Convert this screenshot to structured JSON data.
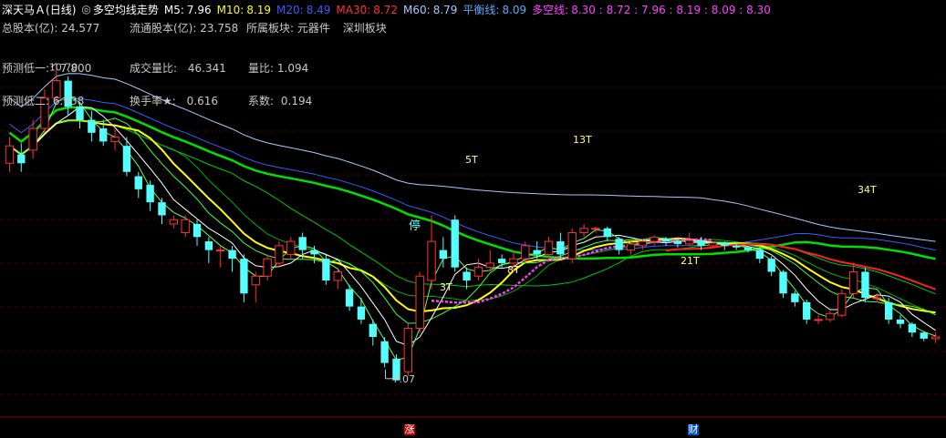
{
  "header": {
    "stock": "深天马Ａ",
    "period": "(日线)",
    "indicator_name": "多空均线走势",
    "ma": [
      {
        "label": "M5:",
        "value": "7.96",
        "color": "#ffffff"
      },
      {
        "label": "M10:",
        "value": "8.19",
        "color": "#ffff00"
      },
      {
        "label": "M20:",
        "value": "8.49",
        "color": "#3a5bff"
      },
      {
        "label": "MA30:",
        "value": "8.72",
        "color": "#ff3030"
      },
      {
        "label": "M60:",
        "value": "8.79",
        "color": "#a6c8ff"
      },
      {
        "label": "平衡线:",
        "value": "8.09",
        "color": "#5fa8ff"
      },
      {
        "label": "多空线:",
        "value": "8.30 : 8.72 : 7.96 : 8.19 : 8.09 : 8.30",
        "color": "#ff40ff"
      }
    ]
  },
  "info": {
    "total_shares_label": "总股本(亿):",
    "total_shares": "24.577",
    "float_shares_label": "流通股本(亿):",
    "float_shares": "23.758",
    "sector_label": "所属板块:",
    "sector": "元器件",
    "board": "深圳板块",
    "pred_low1_label": "预测低一:",
    "pred_low1": "7.800",
    "volume_ratio_label": "成交量比:",
    "volume_ratio": "46.341",
    "liang_bi_label": "量比:",
    "liang_bi": "1.094",
    "pred_low2_label": "预测低二:",
    "pred_low2": "6.938",
    "turnover_label": "换手率★:",
    "turnover": "0.616",
    "coef_label": "系数:",
    "coef": "0.194"
  },
  "annotations": {
    "high_price": "10.70",
    "low_price": "7.07",
    "stop_mark": "停",
    "t5": "5T",
    "t13": "13T",
    "t34": "34T",
    "t3": "3T",
    "t8": "8T",
    "t21": "21T"
  },
  "badges": {
    "zhang": "涨",
    "cai": "财"
  },
  "colors": {
    "up": "#ff3232",
    "down": "#54ffff",
    "grid": "#7a0000",
    "m5": "#ffffff",
    "m10": "#ffff00",
    "ma30": "#ff2020",
    "m60": "#a6c8ff",
    "green_ma": "#00e000",
    "long_short": "#ff40ff"
  },
  "chart_data": {
    "type": "candlestick",
    "ylim": [
      6.9,
      10.8
    ],
    "high": 10.7,
    "low": 7.07,
    "candles": [
      [
        9.55,
        9.75,
        9.45,
        9.85
      ],
      [
        9.65,
        9.55,
        9.45,
        9.78
      ],
      [
        9.7,
        9.95,
        9.6,
        10.05
      ],
      [
        9.95,
        10.3,
        9.9,
        10.4
      ],
      [
        10.3,
        10.5,
        10.25,
        10.7
      ],
      [
        10.5,
        10.2,
        10.1,
        10.55
      ],
      [
        10.2,
        10.05,
        9.95,
        10.25
      ],
      [
        10.05,
        9.9,
        9.8,
        10.15
      ],
      [
        9.95,
        9.8,
        9.75,
        10.05
      ],
      [
        9.8,
        9.85,
        9.7,
        9.95
      ],
      [
        9.75,
        9.45,
        9.4,
        9.85
      ],
      [
        9.4,
        9.25,
        9.15,
        9.45
      ],
      [
        9.3,
        9.1,
        9.0,
        9.35
      ],
      [
        9.1,
        8.95,
        8.85,
        9.15
      ],
      [
        8.85,
        8.9,
        8.8,
        8.95
      ],
      [
        8.75,
        8.9,
        8.7,
        8.95
      ],
      [
        8.85,
        8.7,
        8.6,
        8.9
      ],
      [
        8.65,
        8.55,
        8.4,
        8.7
      ],
      [
        8.55,
        8.55,
        8.35,
        8.6
      ],
      [
        8.55,
        8.45,
        8.3,
        8.6
      ],
      [
        8.45,
        8.05,
        7.95,
        8.5
      ],
      [
        8.15,
        8.25,
        7.95,
        8.3
      ],
      [
        8.25,
        8.45,
        8.2,
        8.5
      ],
      [
        8.4,
        8.6,
        8.35,
        8.65
      ],
      [
        8.5,
        8.65,
        8.45,
        8.7
      ],
      [
        8.7,
        8.55,
        8.45,
        8.75
      ],
      [
        8.55,
        8.5,
        8.4,
        8.6
      ],
      [
        8.45,
        8.2,
        8.15,
        8.5
      ],
      [
        8.2,
        8.3,
        8.1,
        8.35
      ],
      [
        8.1,
        7.9,
        7.85,
        8.15
      ],
      [
        7.9,
        7.75,
        7.7,
        8.0
      ],
      [
        7.7,
        7.55,
        7.45,
        7.75
      ],
      [
        7.5,
        7.25,
        7.2,
        7.55
      ],
      [
        7.3,
        7.05,
        7.07,
        7.35
      ],
      [
        7.15,
        7.65,
        7.1,
        7.7
      ],
      [
        7.65,
        8.25,
        7.6,
        8.3
      ],
      [
        8.2,
        8.65,
        8.1,
        8.95
      ],
      [
        8.55,
        8.45,
        8.35,
        8.7
      ],
      [
        8.9,
        8.35,
        8.3,
        8.95
      ],
      [
        8.3,
        8.2,
        8.1,
        8.35
      ],
      [
        8.25,
        8.35,
        8.2,
        8.45
      ],
      [
        8.35,
        8.4,
        8.3,
        8.55
      ],
      [
        8.45,
        8.4,
        8.35,
        8.5
      ],
      [
        8.4,
        8.45,
        8.3,
        8.55
      ],
      [
        8.45,
        8.6,
        8.4,
        8.65
      ],
      [
        8.55,
        8.5,
        8.45,
        8.65
      ],
      [
        8.5,
        8.65,
        8.45,
        8.7
      ],
      [
        8.65,
        8.5,
        8.45,
        8.75
      ],
      [
        8.45,
        8.75,
        8.4,
        8.8
      ],
      [
        8.75,
        8.8,
        8.7,
        8.85
      ],
      [
        8.8,
        8.8,
        8.75,
        8.82
      ],
      [
        8.8,
        8.7,
        8.65,
        8.82
      ],
      [
        8.68,
        8.55,
        8.5,
        8.7
      ],
      [
        8.55,
        8.62,
        8.5,
        8.65
      ],
      [
        8.6,
        8.65,
        8.55,
        8.68
      ],
      [
        8.65,
        8.7,
        8.6,
        8.72
      ],
      [
        8.68,
        8.65,
        8.6,
        8.7
      ],
      [
        8.65,
        8.62,
        8.58,
        8.68
      ],
      [
        8.62,
        8.66,
        8.6,
        8.75
      ],
      [
        8.66,
        8.6,
        8.55,
        8.7
      ],
      [
        8.6,
        8.63,
        8.58,
        8.65
      ],
      [
        8.63,
        8.6,
        8.55,
        8.65
      ],
      [
        8.6,
        8.58,
        8.55,
        8.62
      ],
      [
        8.58,
        8.55,
        8.52,
        8.6
      ],
      [
        8.55,
        8.45,
        8.4,
        8.58
      ],
      [
        8.45,
        8.3,
        8.25,
        8.48
      ],
      [
        8.3,
        8.05,
        8.0,
        8.32
      ],
      [
        8.05,
        7.95,
        7.9,
        8.08
      ],
      [
        7.95,
        7.75,
        7.7,
        7.98
      ],
      [
        7.75,
        7.75,
        7.7,
        7.8
      ],
      [
        7.75,
        7.82,
        7.72,
        7.85
      ],
      [
        7.8,
        8.05,
        7.78,
        8.1
      ],
      [
        8.05,
        8.3,
        8.0,
        8.4
      ],
      [
        8.3,
        8.0,
        7.95,
        8.35
      ],
      [
        8.0,
        8.0,
        7.95,
        8.05
      ],
      [
        7.95,
        7.75,
        7.7,
        8.0
      ],
      [
        7.75,
        7.7,
        7.65,
        7.8
      ],
      [
        7.7,
        7.6,
        7.55,
        7.72
      ],
      [
        7.6,
        7.53,
        7.5,
        7.62
      ],
      [
        7.53,
        7.55,
        7.48,
        7.6
      ]
    ]
  }
}
